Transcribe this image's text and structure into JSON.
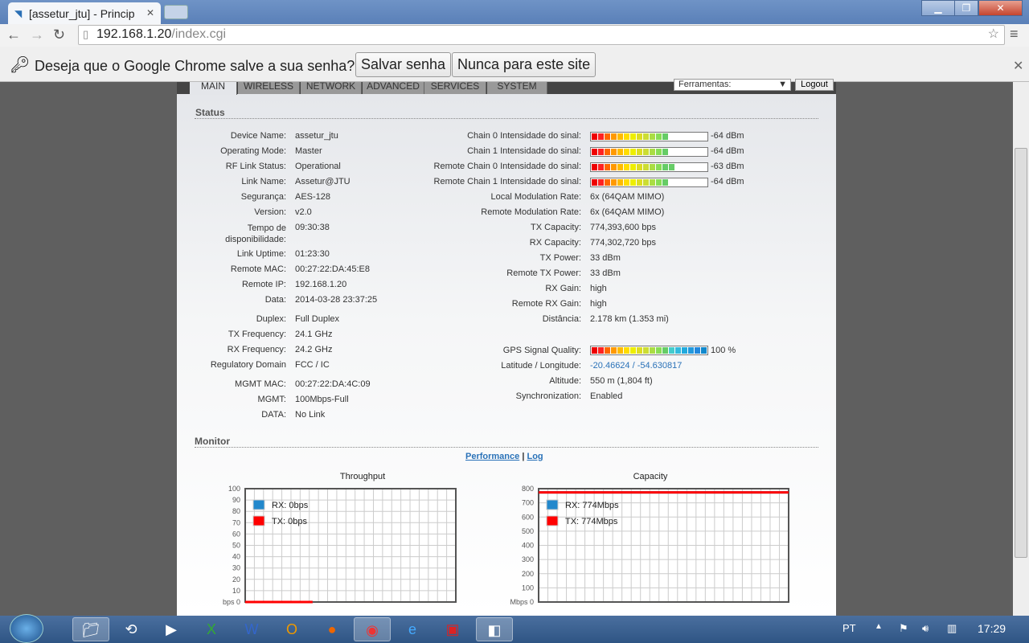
{
  "browser": {
    "tab_title": "[assetur_jtu] - Princip",
    "url_host": "192.168.1.20",
    "url_path": "/index.cgi",
    "infobar": {
      "message": "Deseja que o Google Chrome salve a sua senha?",
      "save": "Salvar senha",
      "never": "Nunca para este site"
    }
  },
  "nav": {
    "tabs": [
      "MAIN",
      "WIRELESS",
      "NETWORK",
      "ADVANCED",
      "SERVICES",
      "SYSTEM"
    ],
    "tools": "Ferramentas:",
    "logout": "Logout"
  },
  "status": {
    "title": "Status",
    "left": [
      {
        "label": "Device Name:",
        "value": "assetur_jtu"
      },
      {
        "label": "Operating Mode:",
        "value": "Master"
      },
      {
        "label": "RF Link Status:",
        "value": "Operational"
      },
      {
        "label": "Link Name:",
        "value": "Assetur@JTU"
      },
      {
        "label": "Segurança:",
        "value": "AES-128"
      },
      {
        "label": "Version:",
        "value": "v2.0"
      },
      {
        "label": "Tempo de disponibilidade:",
        "value": "09:30:38"
      },
      {
        "label": "Link Uptime:",
        "value": "01:23:30"
      },
      {
        "label": "Remote MAC:",
        "value": "00:27:22:DA:45:E8"
      },
      {
        "label": "Remote IP:",
        "value": "192.168.1.20"
      },
      {
        "label": "Data:",
        "value": "2014-03-28 23:37:25"
      },
      {
        "label": "Duplex:",
        "value": "Full Duplex"
      },
      {
        "label": "TX Frequency:",
        "value": "24.1 GHz"
      },
      {
        "label": "RX Frequency:",
        "value": "24.2 GHz"
      },
      {
        "label": "Regulatory Domain",
        "value": "FCC / IC"
      },
      {
        "label": "MGMT MAC:",
        "value": "00:27:22:DA:4C:09"
      },
      {
        "label": "MGMT:",
        "value": "100Mbps-Full"
      },
      {
        "label": "DATA:",
        "value": "No Link"
      }
    ],
    "signals": [
      {
        "label": "Chain 0 Intensidade do sinal:",
        "value": "-64 dBm",
        "level": 0.66
      },
      {
        "label": "Chain 1 Intensidade do sinal:",
        "value": "-64 dBm",
        "level": 0.66
      },
      {
        "label": "Remote Chain 0 Intensidade do sinal:",
        "value": "-63 dBm",
        "level": 0.7
      },
      {
        "label": "Remote Chain 1 Intensidade do sinal:",
        "value": "-64 dBm",
        "level": 0.66
      }
    ],
    "right": [
      {
        "label": "Local Modulation Rate:",
        "value": "6x (64QAM MIMO)"
      },
      {
        "label": "Remote Modulation Rate:",
        "value": "6x (64QAM MIMO)"
      },
      {
        "label": "TX Capacity:",
        "value": "774,393,600 bps"
      },
      {
        "label": "RX Capacity:",
        "value": "774,302,720 bps"
      },
      {
        "label": "TX Power:",
        "value": "33 dBm"
      },
      {
        "label": "Remote TX Power:",
        "value": "33 dBm"
      },
      {
        "label": "RX Gain:",
        "value": "high"
      },
      {
        "label": "Remote RX Gain:",
        "value": "high"
      },
      {
        "label": "Distância:",
        "value": "2.178 km (1.353 mi)"
      }
    ],
    "gps": {
      "label": "GPS Signal Quality:",
      "value": "100 %",
      "level": 1.0
    },
    "gps_rows": [
      {
        "label": "Latitude / Longitude:",
        "value": "-20.46624 / -54.630817"
      },
      {
        "label": "Altitude:",
        "value": "550 m (1,804 ft)"
      },
      {
        "label": "Synchronization:",
        "value": "Enabled"
      }
    ]
  },
  "monitor": {
    "title": "Monitor",
    "performance": "Performance",
    "sep": "|",
    "log": "Log"
  },
  "chart_data": [
    {
      "type": "line",
      "title": "Throughput",
      "ylabel": "bps",
      "ylim": [
        0,
        100
      ],
      "yticks": [
        0,
        10,
        20,
        30,
        40,
        50,
        60,
        70,
        80,
        90,
        100
      ],
      "series": [
        {
          "name": "RX",
          "legend": "RX: 0bps",
          "color": "#2288cc",
          "values": [
            0,
            0,
            0,
            0,
            0,
            0,
            0,
            0
          ]
        },
        {
          "name": "TX",
          "legend": "TX: 0bps",
          "color": "#ff0000",
          "values": [
            0,
            0,
            0,
            0,
            0,
            0,
            0,
            0
          ]
        }
      ],
      "xspan": 0.32
    },
    {
      "type": "line",
      "title": "Capacity",
      "ylabel": "Mbps",
      "ylim": [
        0,
        800
      ],
      "yticks": [
        0,
        100,
        200,
        300,
        400,
        500,
        600,
        700,
        800
      ],
      "series": [
        {
          "name": "RX",
          "legend": "RX: 774Mbps",
          "color": "#2288cc",
          "values": [
            774,
            774
          ]
        },
        {
          "name": "TX",
          "legend": "TX: 774Mbps",
          "color": "#ff0000",
          "values": [
            774,
            774
          ]
        }
      ],
      "xspan": 1.0
    }
  ],
  "taskbar": {
    "lang": "PT",
    "clock": "17:29"
  }
}
